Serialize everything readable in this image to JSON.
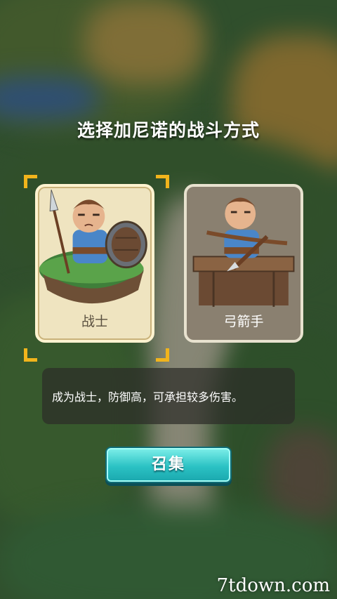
{
  "screen": {
    "title": "选择加尼诺的战斗方式"
  },
  "classes": [
    {
      "label": "战士",
      "selected": true,
      "icon": "warrior-icon"
    },
    {
      "label": "弓箭手",
      "selected": false,
      "icon": "archer-icon"
    }
  ],
  "description": "成为战士，防御高，可承担较多伤害。",
  "summon_button": "召集",
  "watermark": "7tdown.com",
  "colors": {
    "accent": "#2bc2c4",
    "selection_corner": "#f1b41c"
  }
}
